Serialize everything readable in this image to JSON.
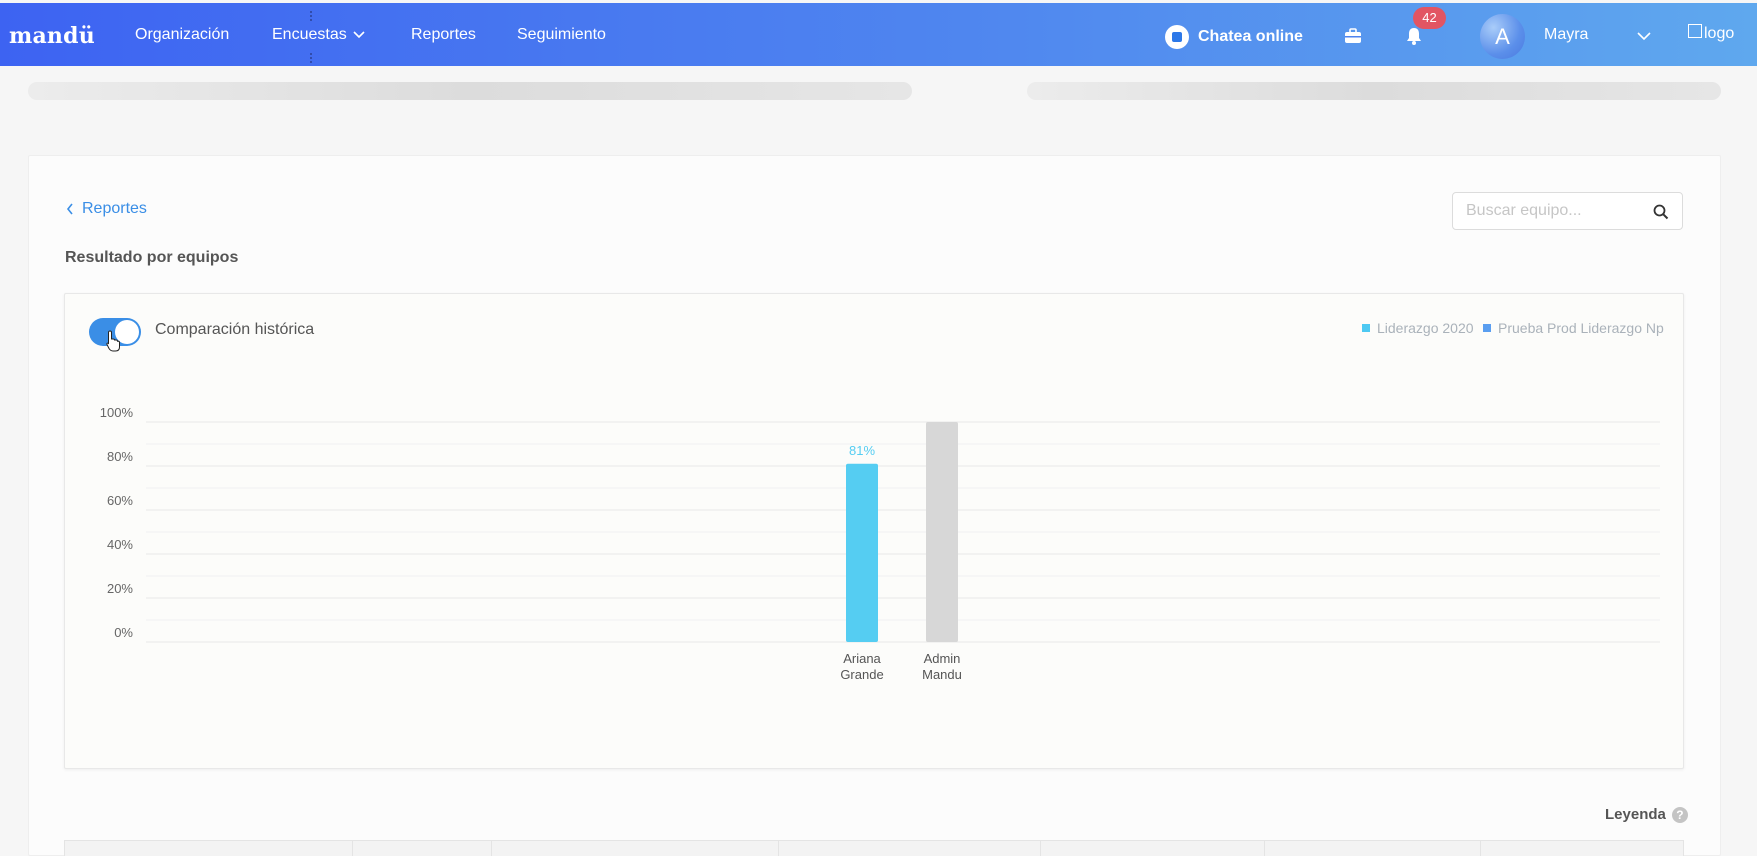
{
  "nav": {
    "brand": "mandü",
    "items": [
      "Organización",
      "Encuestas",
      "Reportes",
      "Seguimiento"
    ],
    "chat_label": "Chatea online",
    "notifications_count": "42",
    "avatar_initial": "A",
    "user_name": "Mayra",
    "logo_alt": "logo"
  },
  "page": {
    "back_label": "Reportes",
    "title": "Resultado por equipos",
    "search_placeholder": "Buscar equipo...",
    "toggle_label": "Comparación histórica",
    "toggle_on": true,
    "legend_footer": "Leyenda",
    "help_glyph": "?"
  },
  "colors": {
    "primary": "#3a8ee6",
    "series_current": "#55cdf2",
    "series_previous": "#d7d7d7",
    "legend_current": "#4ec9f2",
    "legend_previous": "#5a9ef0"
  },
  "chart_data": {
    "type": "bar",
    "categories": [
      "Ariana Grande",
      "Admin Mandu"
    ],
    "category_lines": [
      [
        "Ariana",
        "Grande"
      ],
      [
        "Admin",
        "Mandu"
      ]
    ],
    "series": [
      {
        "name": "Liderazgo 2020",
        "values": [
          81,
          null
        ],
        "color": "#55cdf2",
        "label": [
          "81%",
          null
        ]
      },
      {
        "name": "Prueba Prod Liderazgo Np",
        "values": [
          null,
          100
        ],
        "color": "#d7d7d7",
        "label": [
          null,
          null
        ]
      }
    ],
    "ylim": [
      0,
      100
    ],
    "yticks": [
      "0%",
      "20%",
      "40%",
      "60%",
      "80%",
      "100%"
    ],
    "grid": true,
    "legend_position": "top-right"
  }
}
